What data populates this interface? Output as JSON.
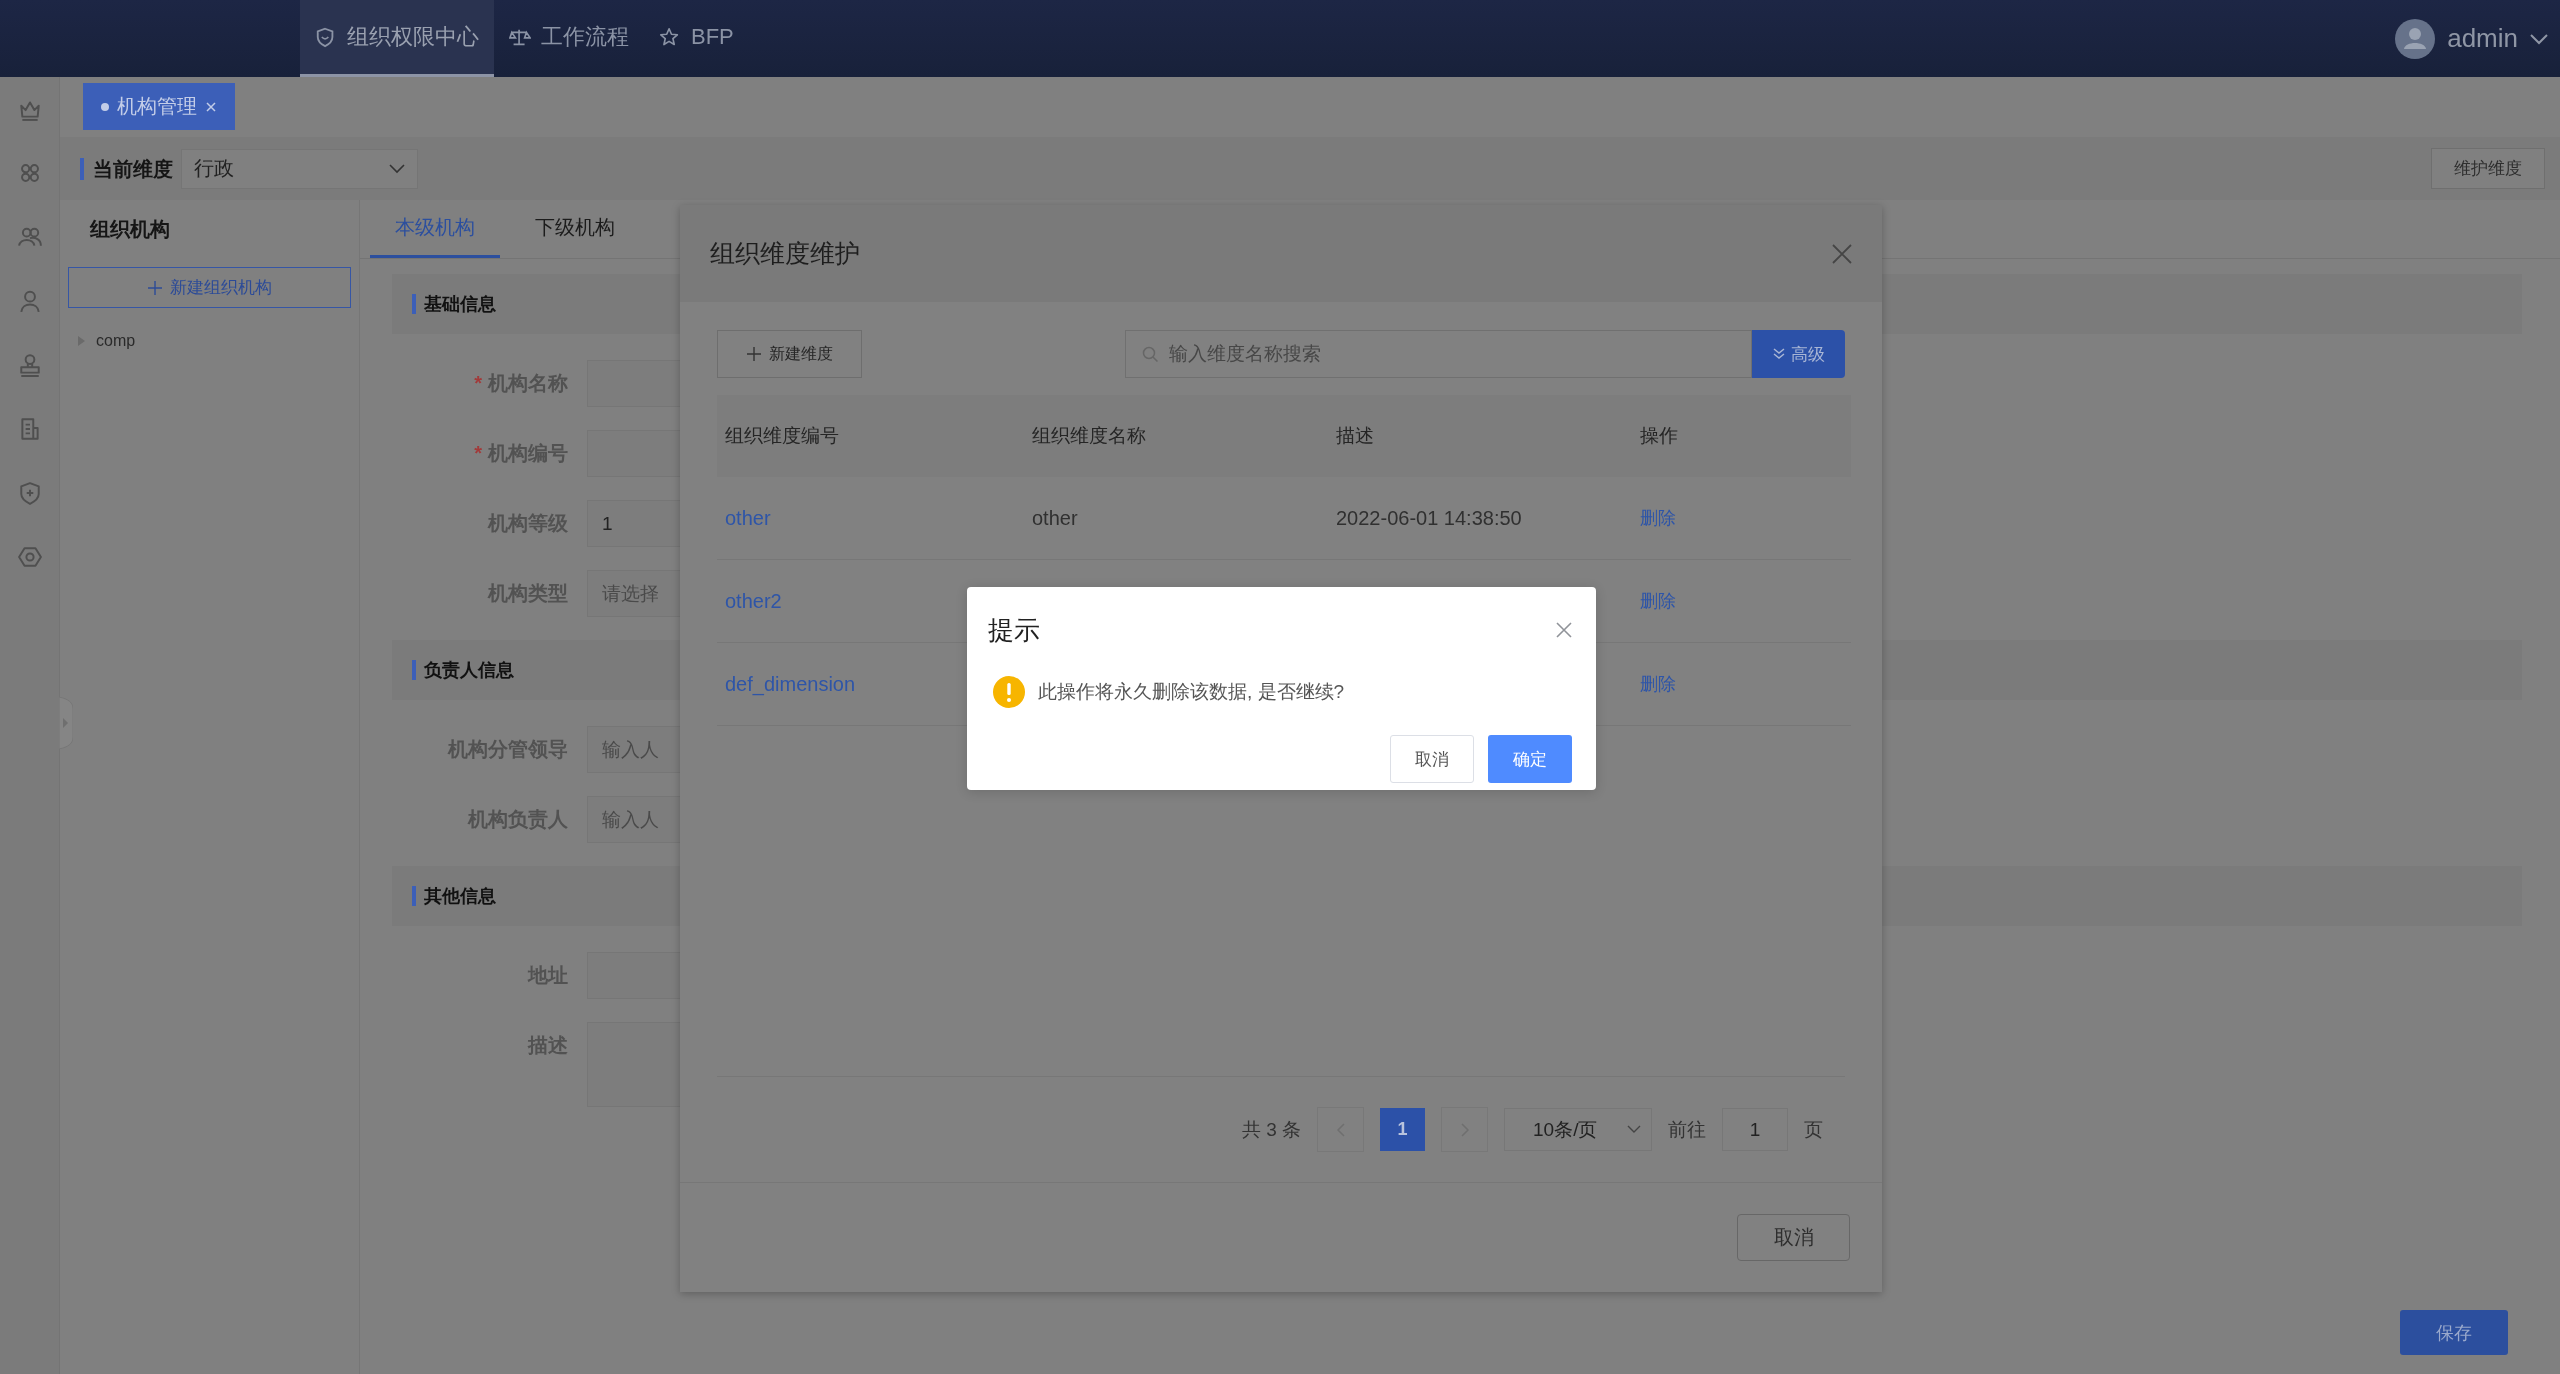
{
  "top_nav": {
    "items": [
      {
        "label": "组织权限中心",
        "selected": true
      },
      {
        "label": "工作流程",
        "selected": false
      },
      {
        "label": "BFP",
        "selected": false
      }
    ],
    "user": "admin"
  },
  "page_tabs": [
    {
      "label": "机构管理",
      "selected": true
    }
  ],
  "dimension_bar": {
    "label": "当前维度",
    "value": "行政",
    "button": "维护维度"
  },
  "org_tree": {
    "title": "组织机构",
    "new_button": "新建组织机构",
    "items": [
      {
        "label": "comp",
        "expanded": false
      }
    ]
  },
  "detail_tabs": [
    {
      "label": "本级机构",
      "selected": true
    },
    {
      "label": "下级机构",
      "selected": false
    }
  ],
  "form_sections": [
    {
      "title": "基础信息",
      "fields": [
        {
          "label": "机构名称",
          "mark": "*",
          "kind": "input"
        },
        {
          "label": "机构编号",
          "mark": "*",
          "kind": "input"
        },
        {
          "label": "机构等级",
          "kind": "input",
          "value": "1"
        },
        {
          "label": "机构类型",
          "kind": "input",
          "placeholder": "请选择"
        }
      ]
    },
    {
      "title": "负责人信息",
      "fields": [
        {
          "label": "机构分管领导",
          "kind": "input",
          "placeholder": "输入人"
        },
        {
          "label": "机构负责人",
          "kind": "input",
          "placeholder": "输入人"
        }
      ]
    },
    {
      "title": "其他信息",
      "fields": [
        {
          "label": "地址",
          "kind": "input"
        },
        {
          "label": "描述",
          "kind": "textarea"
        }
      ]
    }
  ],
  "save_button": "保存",
  "dimension_modal": {
    "title": "组织维度维护",
    "new_button": "新建维度",
    "search_placeholder": "输入维度名称搜索",
    "advanced_button": "高级",
    "table": {
      "columns": [
        "组织维度编号",
        "组织维度名称",
        "描述",
        "操作"
      ],
      "rows": [
        {
          "code": "other",
          "name": "other",
          "description": "2022-06-01 14:38:50",
          "action": "删除"
        },
        {
          "code": "other2",
          "action": "删除"
        },
        {
          "code": "def_dimension",
          "action": "删除"
        }
      ]
    },
    "pagination": {
      "total": "共 3 条",
      "pages": [
        {
          "label": "1",
          "selected": true
        }
      ],
      "page_size": "10条/页",
      "goto_label": "前往",
      "goto_value": "1",
      "page_unit": "页"
    },
    "cancel_button": "取消"
  },
  "confirm_dialog": {
    "title": "提示",
    "message": "此操作将永久删除该数据, 是否继续?",
    "cancel_button": "取消",
    "confirm_button": "确定"
  }
}
